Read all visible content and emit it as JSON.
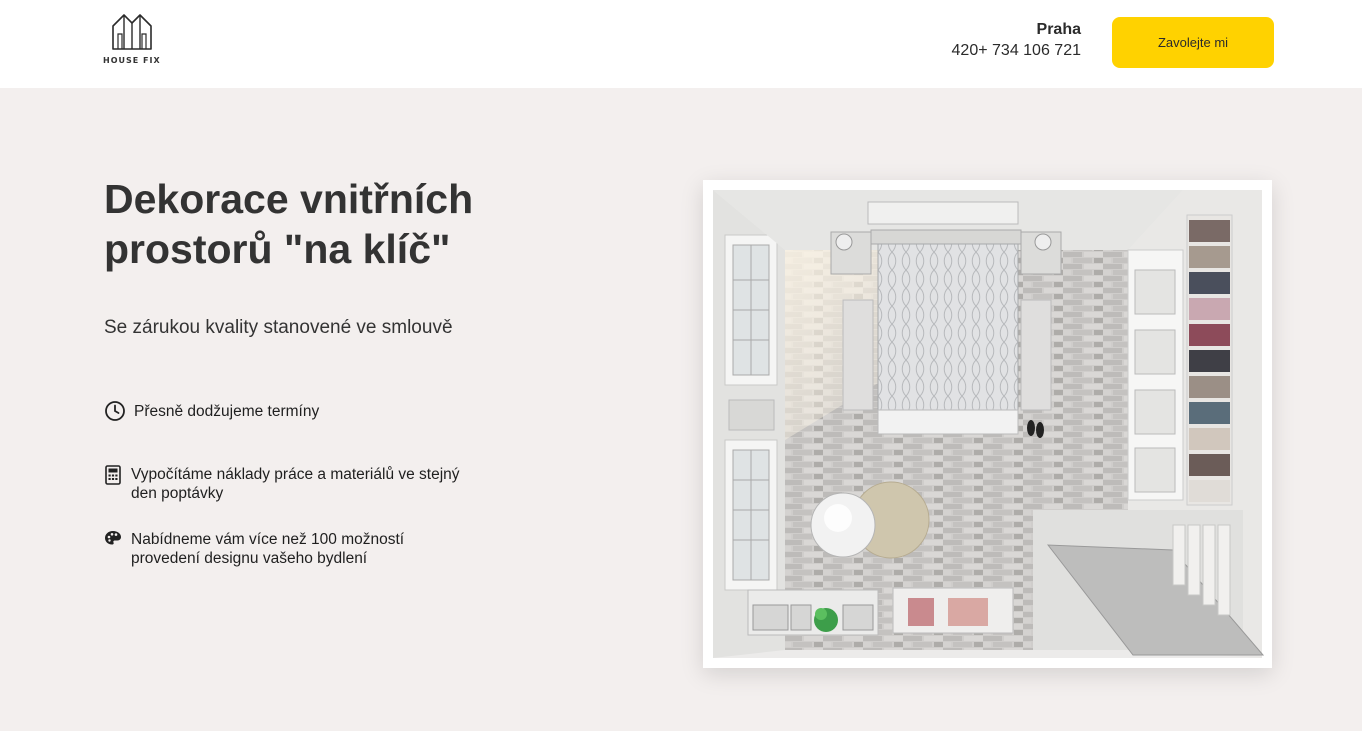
{
  "header": {
    "logo_text": "HOUSE FIX",
    "city": "Praha",
    "phone": "420+ 734 106 721",
    "cta_label": "Zavolejte mi"
  },
  "hero": {
    "title": "Dekorace vnitřních prostorů \"na klíč\"",
    "subtitle": "Se zárukou kvality stanovené ve smlouvě"
  },
  "features": [
    {
      "icon": "clock-icon",
      "text": "Přesně dodžujeme termíny"
    },
    {
      "icon": "calculator-icon",
      "text": "Vypočítáme náklady práce a materiálů ve stejný den poptávky"
    },
    {
      "icon": "palette-icon",
      "text": "Nabídneme vám více než 100 možností provedení designu vašeho bydlení"
    }
  ],
  "colors": {
    "accent": "#ffd200",
    "background": "#f3efee",
    "header_bg": "#ffffff",
    "text": "#2b2b2b"
  }
}
